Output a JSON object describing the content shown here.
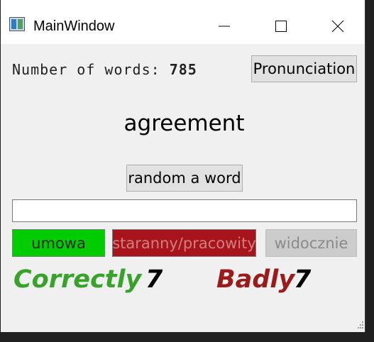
{
  "window": {
    "title": "MainWindow",
    "icon": "app-window-icon"
  },
  "header": {
    "count_label": "Number of words:",
    "count_value": "785",
    "pronunciation_label": "Pronunciation"
  },
  "main": {
    "word": "agreement",
    "random_label": "random a word",
    "answer_value": "",
    "answer_placeholder": "",
    "options": [
      {
        "label": "umowa",
        "color": "#00cc00"
      },
      {
        "label": "staranny/pracowity",
        "color": "#a8141c"
      },
      {
        "label": "widocznie",
        "color": "#cccccc"
      }
    ]
  },
  "score": {
    "correct_label": "Correctly",
    "correct_value": "7",
    "correct_color": "#37a32a",
    "bad_label": "Badly",
    "bad_value": "7",
    "bad_color": "#9b1b1b"
  }
}
